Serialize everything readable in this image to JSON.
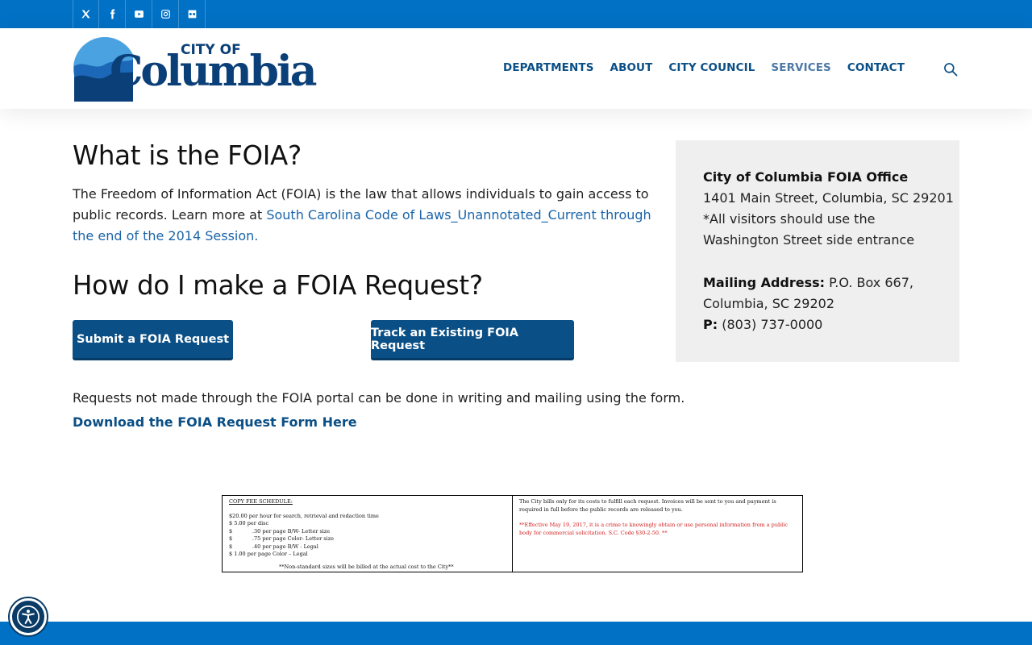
{
  "social": [
    "x-icon",
    "facebook-icon",
    "youtube-icon",
    "instagram-icon",
    "flickr-icon"
  ],
  "logo": {
    "city_of": "CITY OF",
    "name": "Columbia"
  },
  "nav": {
    "departments": "DEPARTMENTS",
    "about": "ABOUT",
    "city_council": "CITY COUNCIL",
    "services": "SERVICES",
    "contact": "CONTACT"
  },
  "main": {
    "heading_what": "What is the FOIA?",
    "para_text": "The Freedom of Information Act (FOIA) is the law that allows individuals to gain access to public records. Learn more at ",
    "para_link": "South Carolina Code of Laws_Unannotated_Current through the end of the 2014 Session.",
    "heading_how": "How do I make a FOIA Request?",
    "submit_button": "Submit a FOIA Request",
    "track_button": "Track an Existing FOIA Request",
    "note": "Requests not made through the FOIA portal can be done in writing and mailing using the form.",
    "download_link": "Download the FOIA Request Form Here"
  },
  "sidebar": {
    "office": "City of Columbia FOIA Office",
    "address": "1401 Main Street, Columbia, SC 29201",
    "visitors_1": "*All visitors should use the",
    "visitors_2": "Washington Street side entrance",
    "mailing_label": "Mailing Address:",
    "mailing_value": " P.O. Box 667,",
    "mailing_city": "Columbia, SC 29202",
    "phone_label": "P:",
    "phone_value": " (803) 737-0000"
  },
  "fee_schedule": {
    "title": "COPY FEE SCHEDULE:",
    "lines": [
      "$20.00 per hour for search, retrieval and redaction time",
      "$ 5.00 per disc",
      "$            .30 per page B/W- Letter size",
      "$            .75 per page Color- Letter size",
      "$            .40 per page B/W - Legal",
      "$ 1.00 per page Color – Legal"
    ],
    "footnote": "**Non-standard sizes will be billed at the actual cost to the City**",
    "right_1": "The City bills only for its costs to fulfill each request. Invoices will be sent to you and payment is",
    "right_2": "required in full before the public records are released to you.",
    "red_1": "**Effective May 19, 2017, it is a crime to knowingly obtain or use personal information from a public",
    "red_2": "body for commercial solicitation. S.C. Code §30-2-50. **"
  },
  "colors": {
    "brand_blue": "#0071c5",
    "nav_blue": "#0a4f86",
    "link_blue": "#1a64a8"
  }
}
